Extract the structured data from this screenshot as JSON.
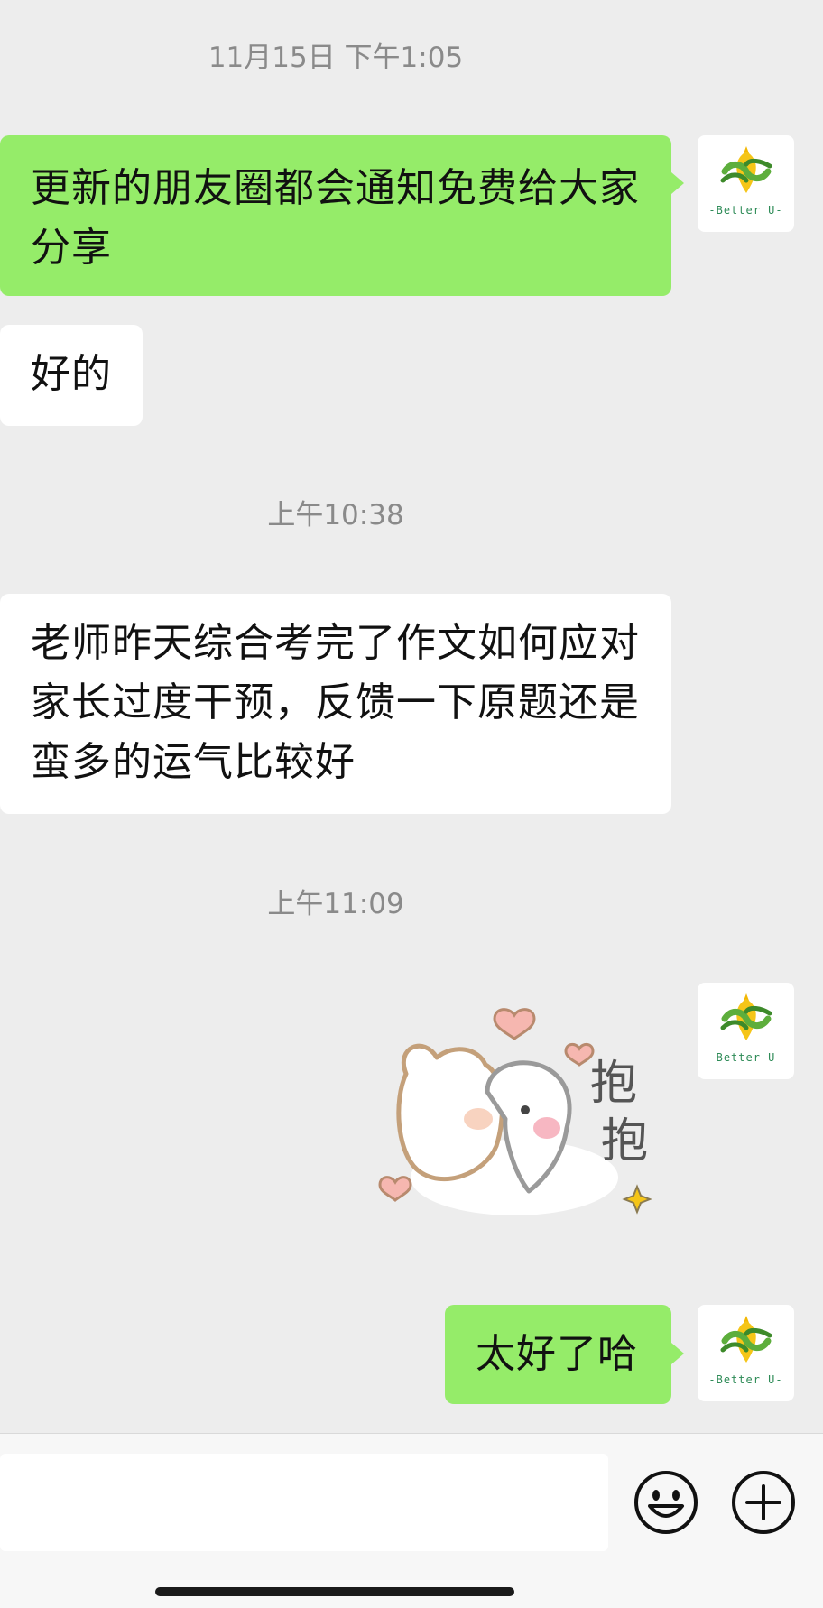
{
  "messages": [
    {
      "type": "timestamp",
      "text": "11月15日 下午1:05"
    },
    {
      "type": "outgoing",
      "lines": [
        "更新的朋友圈都会通知免费给大家",
        "分享"
      ]
    },
    {
      "type": "incoming",
      "lines": [
        "好的"
      ]
    },
    {
      "type": "timestamp",
      "text": "上午10:38"
    },
    {
      "type": "incoming",
      "lines": [
        "老师昨天综合考完了作文如何应对",
        "家长过度干预，反馈一下原题还是",
        "蛮多的运气比较好"
      ]
    },
    {
      "type": "timestamp",
      "text": "上午11:09"
    },
    {
      "type": "outgoing-sticker",
      "sticker_text": "抱抱"
    },
    {
      "type": "outgoing",
      "lines": [
        "太好了哈"
      ]
    }
  ],
  "avatar": {
    "caption": "-Better U-"
  },
  "input_bar": {
    "placeholder": "",
    "emoji_icon": "emoji-icon",
    "plus_icon": "plus-icon"
  },
  "colors": {
    "background": "#ededed",
    "outgoing_bubble": "#95ec69",
    "incoming_bubble": "#ffffff",
    "timestamp": "#8a8a8a"
  }
}
